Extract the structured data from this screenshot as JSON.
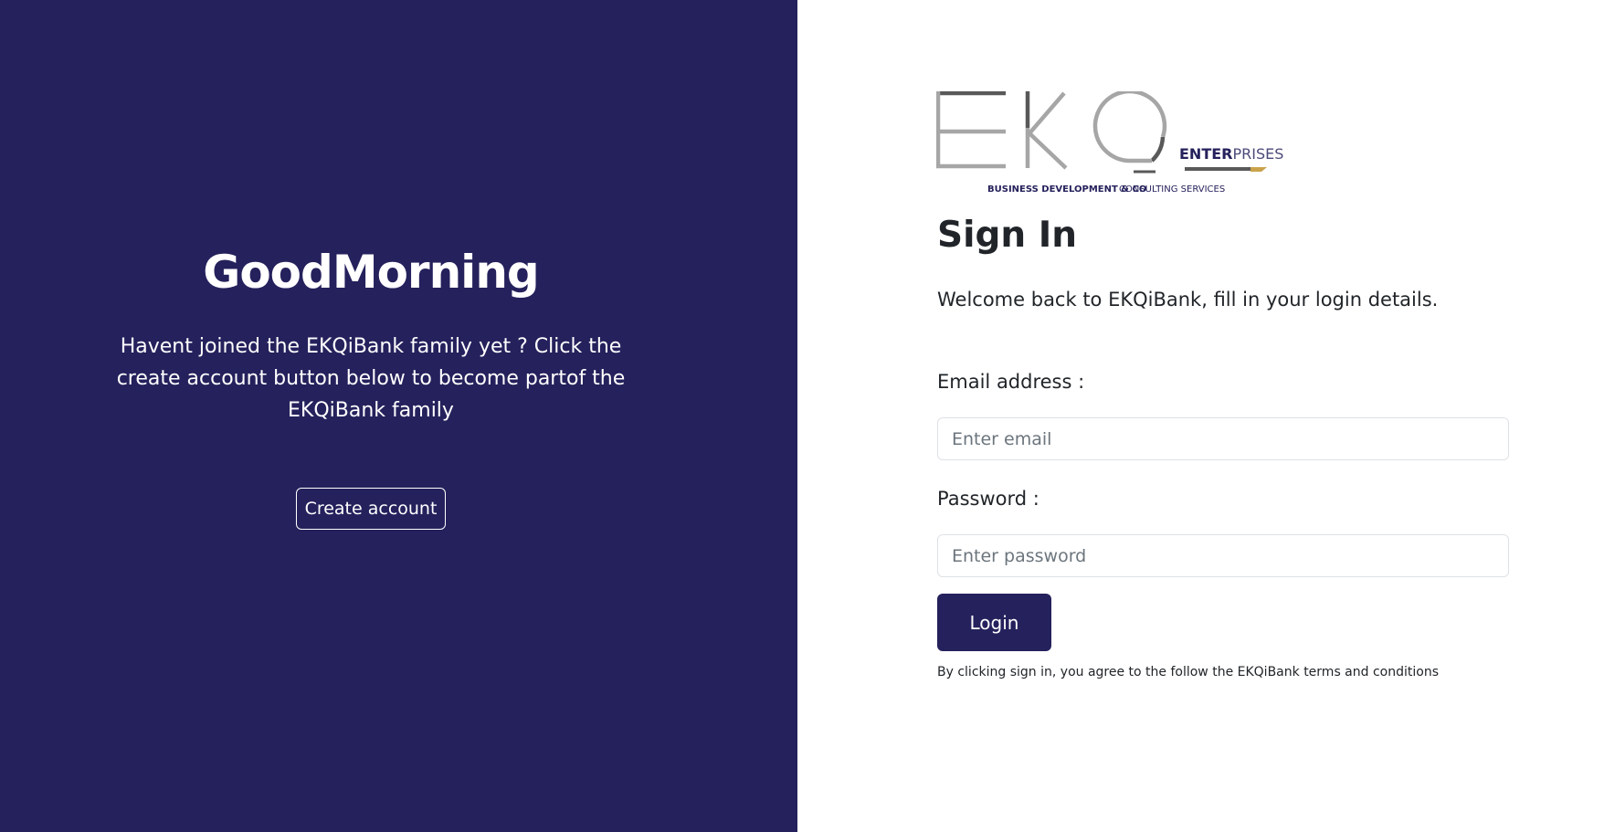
{
  "colors": {
    "brand_navy": "#25215c",
    "page_background": "#ffffff",
    "text_dark": "#212529",
    "logo_grey": "#a6a6a6",
    "logo_dark_grey": "#595959",
    "logo_gold": "#c9a24b"
  },
  "left_panel": {
    "greeting": "GoodMorning",
    "invite_text": "Havent joined the EKQiBank family yet ? Click the create account button below to become partof the EKQiBank family",
    "create_account_label": "Create account"
  },
  "logo": {
    "wordmark": "EKQ",
    "enter_text": "ENTER",
    "prises_text": "PRISES",
    "tagline_left": "BUSINESS DEVELOPMENT & CO",
    "tagline_right": "CONSULTING SERVICES"
  },
  "sign_in": {
    "title": "Sign In",
    "welcome_text": "Welcome back to EKQiBank, fill in your login details.",
    "email_label": "Email address :",
    "email_placeholder": "Enter email",
    "email_value": "",
    "password_label": "Password :",
    "password_placeholder": "Enter password",
    "password_value": "",
    "login_label": "Login",
    "terms_text": "By clicking sign in, you agree to the follow the EKQiBank terms and conditions"
  }
}
